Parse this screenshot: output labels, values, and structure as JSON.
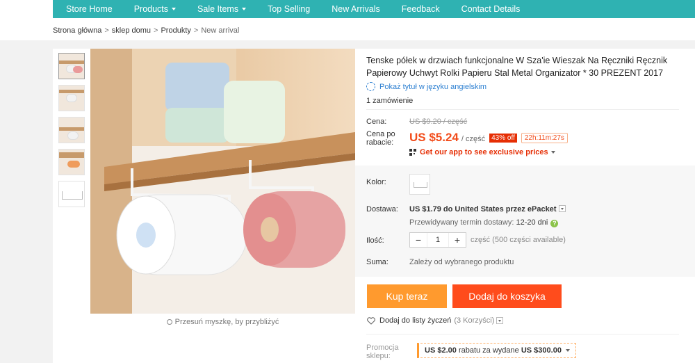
{
  "nav": {
    "items": [
      {
        "label": "Store Home",
        "dropdown": false
      },
      {
        "label": "Products",
        "dropdown": true
      },
      {
        "label": "Sale Items",
        "dropdown": true
      },
      {
        "label": "Top Selling",
        "dropdown": false
      },
      {
        "label": "New Arrivals",
        "dropdown": false
      },
      {
        "label": "Feedback",
        "dropdown": false
      },
      {
        "label": "Contact Details",
        "dropdown": false
      }
    ],
    "bg_color": "#2fb2b2"
  },
  "breadcrumb": {
    "items": [
      "Strona główna",
      "sklep domu",
      "Produkty"
    ],
    "current": "New arrival",
    "separator": ">"
  },
  "gallery": {
    "hint": "Przesuń myszkę, by przybliżyć"
  },
  "product": {
    "title": "Tenske półek w drzwiach funkcjonalne W Sza'ie Wieszak Na Ręczniki Ręcznik Papierowy Uchwyt Rolki Papieru Stal Metal Organizator * 30 PREZENT 2017",
    "translate_link": "Pokaż tytuł w języku angielskim",
    "orders": "1 zamówienie"
  },
  "price": {
    "label": "Cena:",
    "old": "US $9.20 / część",
    "discount_label": "Cena po rabacie:",
    "new": "US $5.24",
    "per": "/ część",
    "off_badge": "43% off",
    "timer": "22h:11m:27s",
    "app_promo": "Get our app to see exclusive prices",
    "accent_color": "#f24d1c"
  },
  "options": {
    "color_label": "Kolor:",
    "shipping_label": "Dostawa:",
    "shipping_value": "US $1.79 do United States przez ePacket",
    "delivery_est": "Przewidywany termin dostawy:",
    "delivery_days": "12-20",
    "delivery_unit": "dni",
    "help_glyph": "?",
    "qty_label": "Ilość:",
    "qty_minus": "−",
    "qty_value": "1",
    "qty_plus": "+",
    "qty_available": "część (500 części available)",
    "total_label": "Suma:",
    "total_value": "Zależy od wybranego produktu"
  },
  "actions": {
    "buy_now": "Kup teraz",
    "add_to_cart": "Dodaj do koszyka",
    "wishlist": "Dodaj do listy życzeń",
    "wishlist_count": "(3 Korzyści)"
  },
  "promo": {
    "label": "Promocja sklepu:",
    "coupon_amount": "US $2.00",
    "coupon_text": "rabatu za wydane",
    "coupon_threshold": "US $300.00"
  }
}
